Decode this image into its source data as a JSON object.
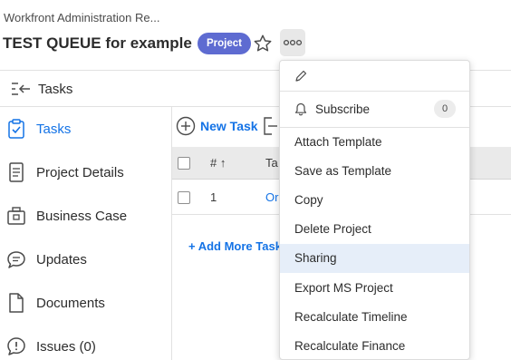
{
  "header": {
    "breadcrumb": "Workfront Administration Re...",
    "title": "TEST QUEUE for example",
    "badge": "Project"
  },
  "collapse_bar": {
    "label": "Tasks"
  },
  "sidebar": {
    "items": [
      {
        "label": "Tasks",
        "icon": "clipboard-check-icon",
        "active": true
      },
      {
        "label": "Project Details",
        "icon": "document-icon"
      },
      {
        "label": "Business Case",
        "icon": "briefcase-icon"
      },
      {
        "label": "Updates",
        "icon": "speech-bubble-icon"
      },
      {
        "label": "Documents",
        "icon": "file-icon"
      },
      {
        "label": "Issues (0)",
        "icon": "issue-icon"
      }
    ]
  },
  "toolbar": {
    "new_task_label": "New Task"
  },
  "grid": {
    "headers": {
      "number": "# ↑",
      "task": "Ta"
    },
    "rows": [
      {
        "number": "1",
        "task": "Or"
      }
    ],
    "add_more_label": "+ Add More Task"
  },
  "menu": {
    "subscribe_label": "Subscribe",
    "subscribe_count": "0",
    "items": [
      "Attach Template",
      "Save as Template",
      "Copy",
      "Delete Project",
      "Sharing",
      "Export MS Project",
      "Recalculate Timeline",
      "Recalculate Finance"
    ],
    "highlighted": "Sharing"
  },
  "colors": {
    "accent_blue": "#1473e6",
    "badge_purple": "#5e6bd1",
    "menu_highlight": "#e6eef9"
  }
}
